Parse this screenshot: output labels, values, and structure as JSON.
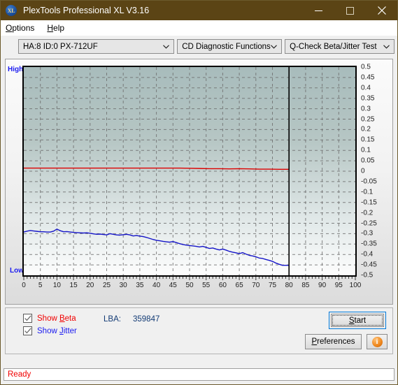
{
  "window": {
    "title": "PlexTools Professional XL V3.16",
    "icon": "XL",
    "minimize": "minimize-icon",
    "maximize": "maximize-icon",
    "close": "close-icon",
    "titlebar_color": "#5b4415"
  },
  "menubar": {
    "items": [
      {
        "label": "Options",
        "accel": "O"
      },
      {
        "label": "Help",
        "accel": "H"
      }
    ]
  },
  "toolbar": {
    "device": "HA:8 ID:0  PX-712UF",
    "function": "CD Diagnostic Functions",
    "test": "Q-Check Beta/Jitter Test"
  },
  "controls": {
    "show_beta": {
      "label_pre": "Show ",
      "label_accel": "B",
      "label_post": "eta",
      "checked": true,
      "color": "#f00000"
    },
    "show_jitter": {
      "label_pre": "Show ",
      "label_accel": "J",
      "label_post": "itter",
      "checked": true,
      "color": "#1a1af0"
    },
    "lba_label": "LBA:",
    "lba_value": "359847",
    "start_pre": "S",
    "start_accel": "t",
    "start_post": "art",
    "prefs_pre": "P",
    "prefs_accel": "r",
    "prefs_post": "eferences",
    "info_glyph": "i"
  },
  "statusbar": {
    "text": "Ready"
  },
  "chart_data": {
    "type": "line",
    "title": "Q-Check Beta/Jitter Test",
    "xlabel": "",
    "ylabel": "",
    "grid": true,
    "legend_position": "none",
    "xlim": [
      0,
      100
    ],
    "ylim": [
      -0.5,
      0.5
    ],
    "xticks": [
      0,
      5,
      10,
      15,
      20,
      25,
      30,
      35,
      40,
      45,
      50,
      55,
      60,
      65,
      70,
      75,
      80,
      85,
      90,
      95,
      100
    ],
    "yticks": [
      0.5,
      0.45,
      0.4,
      0.35,
      0.3,
      0.25,
      0.2,
      0.15,
      0.1,
      0.05,
      0,
      -0.05,
      -0.1,
      -0.15,
      -0.2,
      -0.25,
      -0.3,
      -0.35,
      -0.4,
      -0.45,
      -0.5
    ],
    "left_axis_top_label": "High",
    "left_axis_bottom_label": "Low",
    "data_end_marker_x": 80,
    "series": [
      {
        "name": "Beta",
        "color": "#dd0000",
        "x": [
          0,
          2,
          5,
          8,
          11,
          14,
          17,
          20,
          23,
          26,
          29,
          32,
          35,
          38,
          41,
          44,
          47,
          50,
          53,
          56,
          59,
          62,
          65,
          68,
          71,
          74,
          77,
          80
        ],
        "values": [
          0.015,
          0.015,
          0.015,
          0.015,
          0.015,
          0.015,
          0.015,
          0.015,
          0.015,
          0.015,
          0.015,
          0.015,
          0.015,
          0.015,
          0.015,
          0.015,
          0.015,
          0.014,
          0.013,
          0.012,
          0.012,
          0.011,
          0.012,
          0.011,
          0.01,
          0.01,
          0.009,
          0.009
        ]
      },
      {
        "name": "Jitter",
        "color": "#1414c8",
        "x": [
          0,
          1,
          2,
          3,
          4,
          5,
          6,
          7,
          8,
          9,
          10,
          11,
          12,
          13,
          14,
          15,
          16,
          17,
          18,
          19,
          20,
          21,
          22,
          23,
          24,
          25,
          26,
          27,
          28,
          29,
          30,
          31,
          32,
          33,
          34,
          35,
          36,
          37,
          38,
          39,
          40,
          41,
          42,
          43,
          44,
          45,
          46,
          47,
          48,
          49,
          50,
          51,
          52,
          53,
          54,
          55,
          56,
          57,
          58,
          59,
          60,
          61,
          62,
          63,
          64,
          65,
          66,
          67,
          68,
          69,
          70,
          71,
          72,
          73,
          74,
          75,
          76,
          77,
          78,
          79,
          80
        ],
        "values": [
          -0.292,
          -0.288,
          -0.285,
          -0.287,
          -0.289,
          -0.291,
          -0.291,
          -0.292,
          -0.292,
          -0.288,
          -0.278,
          -0.286,
          -0.291,
          -0.29,
          -0.292,
          -0.294,
          -0.295,
          -0.296,
          -0.297,
          -0.296,
          -0.298,
          -0.301,
          -0.303,
          -0.302,
          -0.304,
          -0.306,
          -0.3,
          -0.303,
          -0.306,
          -0.307,
          -0.305,
          -0.303,
          -0.306,
          -0.311,
          -0.309,
          -0.312,
          -0.314,
          -0.318,
          -0.323,
          -0.328,
          -0.332,
          -0.334,
          -0.337,
          -0.339,
          -0.341,
          -0.338,
          -0.343,
          -0.348,
          -0.352,
          -0.355,
          -0.357,
          -0.359,
          -0.361,
          -0.364,
          -0.361,
          -0.366,
          -0.371,
          -0.369,
          -0.374,
          -0.378,
          -0.374,
          -0.379,
          -0.385,
          -0.389,
          -0.392,
          -0.396,
          -0.391,
          -0.398,
          -0.404,
          -0.407,
          -0.411,
          -0.417,
          -0.419,
          -0.424,
          -0.428,
          -0.433,
          -0.441,
          -0.447,
          -0.452,
          -0.452,
          -0.452
        ]
      }
    ]
  }
}
